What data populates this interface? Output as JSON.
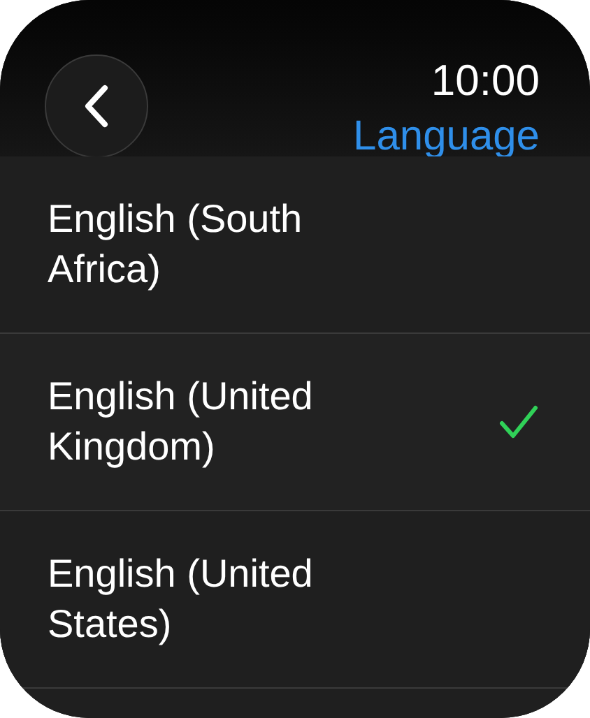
{
  "status": {
    "time": "10:00"
  },
  "header": {
    "title": "Language"
  },
  "languages": [
    {
      "label": "English (South Africa)",
      "selected": false
    },
    {
      "label": "English (United Kingdom)",
      "selected": true
    },
    {
      "label": "English (United States)",
      "selected": false
    }
  ]
}
